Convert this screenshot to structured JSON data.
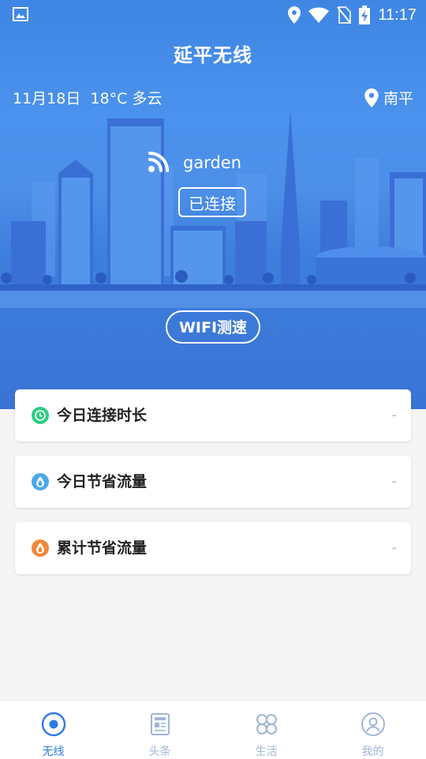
{
  "status_bar": {
    "time": "11:17",
    "icons": [
      "image-icon",
      "location-icon",
      "wifi-icon",
      "no-sim-icon",
      "battery-charging-icon"
    ]
  },
  "app": {
    "title": "延平无线"
  },
  "weather": {
    "date": "11月18日",
    "temperature": "18°C",
    "condition": "多云",
    "location": "南平"
  },
  "wifi": {
    "ssid": "garden",
    "status": "已连接",
    "speed_test_label": "WIFI测速"
  },
  "stats": [
    {
      "label": "今日连接时长",
      "value": "-",
      "icon": "clock-icon",
      "color": "#2ecc87"
    },
    {
      "label": "今日节省流量",
      "value": "-",
      "icon": "drop-icon",
      "color": "#4aa8e8"
    },
    {
      "label": "累计节省流量",
      "value": "-",
      "icon": "flame-icon",
      "color": "#f0883a"
    }
  ],
  "tabs": [
    {
      "label": "无线",
      "icon": "wireless-icon",
      "active": true
    },
    {
      "label": "头条",
      "icon": "news-icon",
      "active": false
    },
    {
      "label": "生活",
      "icon": "life-grid-icon",
      "active": false
    },
    {
      "label": "我的",
      "icon": "profile-icon",
      "active": false
    }
  ],
  "colors": {
    "primary": "#2c7be5",
    "hero_top": "#3f86e4",
    "tab_inactive": "#9fb6d6"
  }
}
